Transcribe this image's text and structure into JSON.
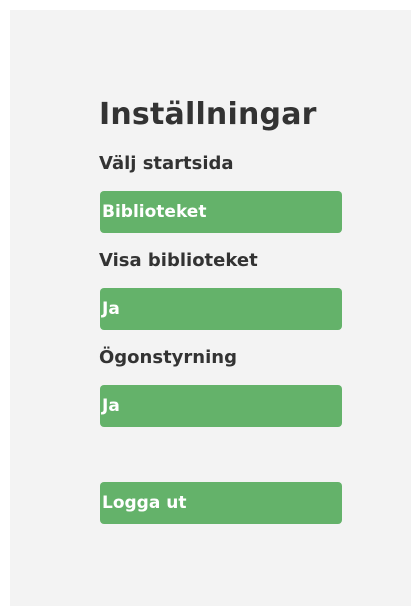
{
  "settings": {
    "title": "Inställningar",
    "start_page": {
      "label": "Välj startsida",
      "value": "Biblioteket"
    },
    "show_library": {
      "label": "Visa biblioteket",
      "value": "Ja"
    },
    "eye_tracking": {
      "label": "Ögonstyrning",
      "value": "Ja"
    },
    "logout_label": "Logga ut"
  },
  "colors": {
    "panel_background": "#f3f3f3",
    "button_green": "#64b26a",
    "text_dark": "#333333"
  }
}
